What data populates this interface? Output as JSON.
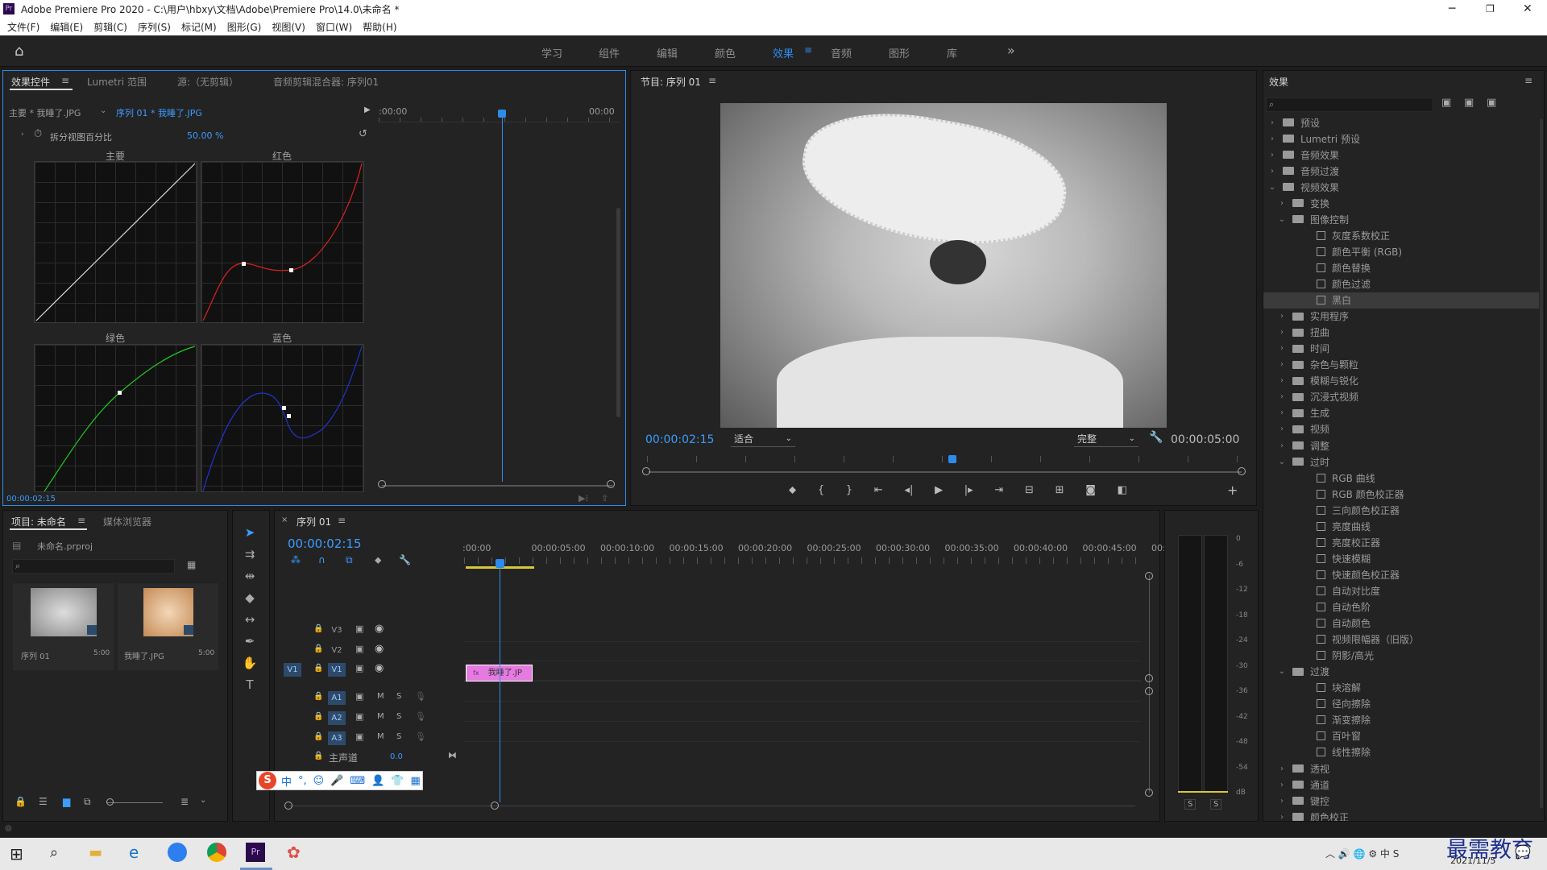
{
  "window": {
    "app_badge": "Pr",
    "title": "Adobe Premiere Pro 2020 - C:\\用户\\hbxy\\文档\\Adobe\\Premiere Pro\\14.0\\未命名 *"
  },
  "menu": [
    "文件(F)",
    "编辑(E)",
    "剪辑(C)",
    "序列(S)",
    "标记(M)",
    "图形(G)",
    "视图(V)",
    "窗口(W)",
    "帮助(H)"
  ],
  "workspaces": [
    "学习",
    "组件",
    "编辑",
    "颜色",
    "效果",
    "音频",
    "图形",
    "库"
  ],
  "active_workspace": "效果",
  "effect_controls": {
    "tabs": [
      "效果控件",
      "Lumetri 范围",
      "源:（无剪辑）",
      "音频剪辑混合器: 序列01"
    ],
    "clip_path_main": "主要 * 我睡了.JPG",
    "clip_path_seq": "序列 01 * 我睡了.JPG",
    "split_label": "拆分视图百分比",
    "split_value": "50.00 %",
    "timeline_start": ":00:00",
    "timeline_end": "00:00",
    "curve_labels": {
      "main": "主要",
      "red": "红色",
      "green": "绿色",
      "blue": "蓝色"
    },
    "timecode": "00:00:02:15"
  },
  "program": {
    "title": "节目: 序列 01",
    "timecode": "00:00:02:15",
    "fit": "适合",
    "quality": "完整",
    "duration": "00:00:05:00"
  },
  "effects_panel": {
    "title": "效果",
    "tree": [
      {
        "label": "预设",
        "depth": 0,
        "kind": "folder",
        "open": false
      },
      {
        "label": "Lumetri 预设",
        "depth": 0,
        "kind": "folder",
        "open": false
      },
      {
        "label": "音频效果",
        "depth": 0,
        "kind": "folder",
        "open": false
      },
      {
        "label": "音频过渡",
        "depth": 0,
        "kind": "folder",
        "open": false
      },
      {
        "label": "视频效果",
        "depth": 0,
        "kind": "folder",
        "open": true
      },
      {
        "label": "变换",
        "depth": 1,
        "kind": "folder",
        "open": false
      },
      {
        "label": "图像控制",
        "depth": 1,
        "kind": "folder",
        "open": true
      },
      {
        "label": "灰度系数校正",
        "depth": 2,
        "kind": "fx"
      },
      {
        "label": "颜色平衡 (RGB)",
        "depth": 2,
        "kind": "fx"
      },
      {
        "label": "颜色替换",
        "depth": 2,
        "kind": "fx"
      },
      {
        "label": "颜色过滤",
        "depth": 2,
        "kind": "fx"
      },
      {
        "label": "黑白",
        "depth": 2,
        "kind": "fx",
        "selected": true
      },
      {
        "label": "实用程序",
        "depth": 1,
        "kind": "folder",
        "open": false
      },
      {
        "label": "扭曲",
        "depth": 1,
        "kind": "folder",
        "open": false
      },
      {
        "label": "时间",
        "depth": 1,
        "kind": "folder",
        "open": false
      },
      {
        "label": "杂色与颗粒",
        "depth": 1,
        "kind": "folder",
        "open": false
      },
      {
        "label": "模糊与锐化",
        "depth": 1,
        "kind": "folder",
        "open": false
      },
      {
        "label": "沉浸式视频",
        "depth": 1,
        "kind": "folder",
        "open": false
      },
      {
        "label": "生成",
        "depth": 1,
        "kind": "folder",
        "open": false
      },
      {
        "label": "视频",
        "depth": 1,
        "kind": "folder",
        "open": false
      },
      {
        "label": "调整",
        "depth": 1,
        "kind": "folder",
        "open": false
      },
      {
        "label": "过时",
        "depth": 1,
        "kind": "folder",
        "open": true
      },
      {
        "label": "RGB 曲线",
        "depth": 2,
        "kind": "fx"
      },
      {
        "label": "RGB 颜色校正器",
        "depth": 2,
        "kind": "fx"
      },
      {
        "label": "三向颜色校正器",
        "depth": 2,
        "kind": "fx"
      },
      {
        "label": "亮度曲线",
        "depth": 2,
        "kind": "fx"
      },
      {
        "label": "亮度校正器",
        "depth": 2,
        "kind": "fx"
      },
      {
        "label": "快速模糊",
        "depth": 2,
        "kind": "fx"
      },
      {
        "label": "快速颜色校正器",
        "depth": 2,
        "kind": "fx"
      },
      {
        "label": "自动对比度",
        "depth": 2,
        "kind": "fx"
      },
      {
        "label": "自动色阶",
        "depth": 2,
        "kind": "fx"
      },
      {
        "label": "自动颜色",
        "depth": 2,
        "kind": "fx"
      },
      {
        "label": "视频限幅器（旧版）",
        "depth": 2,
        "kind": "fx"
      },
      {
        "label": "阴影/高光",
        "depth": 2,
        "kind": "fx"
      },
      {
        "label": "过渡",
        "depth": 1,
        "kind": "folder",
        "open": true
      },
      {
        "label": "块溶解",
        "depth": 2,
        "kind": "fx"
      },
      {
        "label": "径向擦除",
        "depth": 2,
        "kind": "fx"
      },
      {
        "label": "渐变擦除",
        "depth": 2,
        "kind": "fx"
      },
      {
        "label": "百叶窗",
        "depth": 2,
        "kind": "fx"
      },
      {
        "label": "线性擦除",
        "depth": 2,
        "kind": "fx"
      },
      {
        "label": "透视",
        "depth": 1,
        "kind": "folder",
        "open": false
      },
      {
        "label": "通道",
        "depth": 1,
        "kind": "folder",
        "open": false
      },
      {
        "label": "键控",
        "depth": 1,
        "kind": "folder",
        "open": false
      },
      {
        "label": "颜色校正",
        "depth": 1,
        "kind": "folder",
        "open": false
      }
    ]
  },
  "project": {
    "tabs": [
      "项目: 未命名",
      "媒体浏览器"
    ],
    "file": "未命名.prproj",
    "items": [
      {
        "name": "序列 01",
        "duration": "5:00"
      },
      {
        "name": "我睡了.JPG",
        "duration": "5:00"
      }
    ]
  },
  "timeline": {
    "tab": "序列 01",
    "timecode": "00:00:02:15",
    "ruler": [
      ":00:00",
      "00:00:05:00",
      "00:00:10:00",
      "00:00:15:00",
      "00:00:20:00",
      "00:00:25:00",
      "00:00:30:00",
      "00:00:35:00",
      "00:00:40:00",
      "00:00:45:00",
      "00:0("
    ],
    "video_tracks": [
      "V3",
      "V2",
      "V1"
    ],
    "audio_tracks": [
      "A1",
      "A2",
      "A3"
    ],
    "source_patch": "V1",
    "master_label": "主声道",
    "master_value": "0.0",
    "clip_label": "我睡了.JP",
    "track_btn_m": "M",
    "track_btn_s": "S"
  },
  "meter": {
    "scale": [
      "0",
      "-6",
      "-12",
      "-18",
      "-24",
      "-30",
      "-36",
      "-42",
      "-48",
      "-54",
      "dB"
    ],
    "solo": [
      "S",
      "S"
    ]
  },
  "taskbar": {
    "date": "2021/11/5",
    "watermark": "最需教育"
  },
  "colors": {
    "accent": "#2d8ceb",
    "panel": "#232323",
    "selection_bg": "#3b3b3b",
    "clip": "#e57ae0"
  }
}
